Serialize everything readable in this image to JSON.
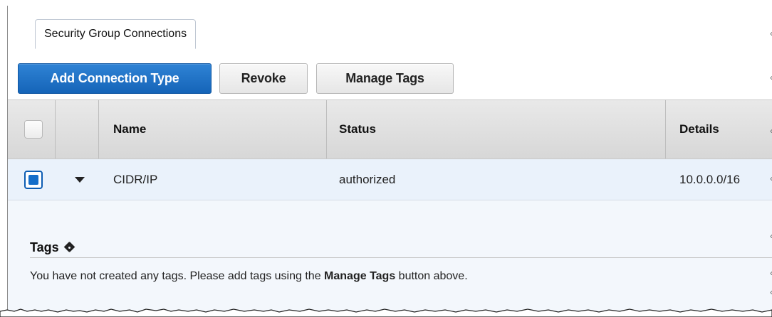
{
  "page": {
    "top_partial_text_regular": "",
    "top_partial_text_bold": "",
    "tab": {
      "label": "Security Group Connections"
    },
    "toolbar": {
      "add_connection_type": "Add Connection Type",
      "revoke": "Revoke",
      "manage_tags": "Manage Tags"
    },
    "table": {
      "headers": {
        "name": "Name",
        "status": "Status",
        "details": "Details"
      },
      "rows": [
        {
          "name": "CIDR/IP",
          "status": "authorized",
          "details": "10.0.0.0/16",
          "selected": true,
          "expanded": true
        }
      ]
    },
    "details": {
      "tags_title": "Tags",
      "tags_note_prefix": "You have not created any tags. Please add tags using the ",
      "tags_note_bold": "Manage Tags",
      "tags_note_suffix": " button above."
    },
    "colors": {
      "primary_button": "#1f73c9",
      "status_authorized": "#2f9b39",
      "selected_row": "#eaf2fb",
      "detail_panel": "#f3f7fc"
    },
    "icons": {
      "expand": "caret-down-icon",
      "tag": "tag-icon"
    }
  }
}
